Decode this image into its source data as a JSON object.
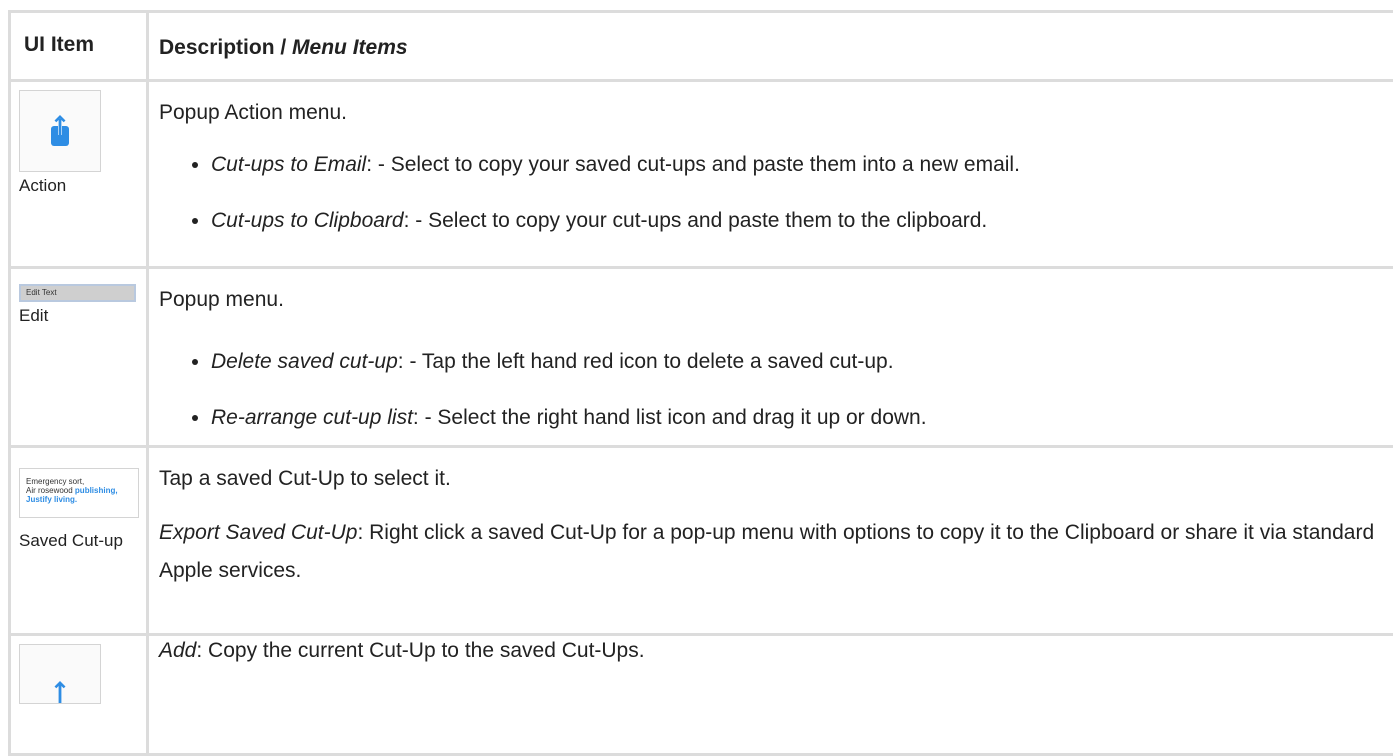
{
  "header": {
    "col1": "UI Item",
    "col2_plain": "Description / ",
    "col2_italic": "Menu Items"
  },
  "rows": {
    "action": {
      "icon": "share-icon",
      "label": "Action",
      "intro": "Popup Action menu.",
      "items": [
        {
          "term": "Cut-ups to Email",
          "text": ": - Select to copy your saved cut-ups and paste them into a new email."
        },
        {
          "term": "Cut-ups to Clipboard",
          "text": ": - Select to copy your cut-ups and paste them to the clipboard."
        }
      ]
    },
    "edit": {
      "button_text": "Edit Text",
      "label": "Edit",
      "intro": "Popup menu.",
      "items": [
        {
          "term": "Delete saved cut-up",
          "text": ": - Tap the left hand red icon to delete a saved cut-up."
        },
        {
          "term": "Re-arrange cut-up list",
          "text": ": - Select the right hand list icon and drag it up or down."
        }
      ]
    },
    "saved": {
      "thumb_line1": "Emergency sort,",
      "thumb_line2_plain": "Air rosewood ",
      "thumb_line2_blue": "publishing,",
      "thumb_line3_blue": "Justify living.",
      "label": "Saved Cut-up",
      "intro": "Tap a saved Cut-Up to select it.",
      "export_term": "Export Saved Cut-Up",
      "export_text": ": Right click a saved Cut-Up for a pop-up menu with options to copy it to the Clipboard or share it via standard Apple services."
    },
    "add": {
      "icon": "share-icon",
      "term": "Add",
      "text": ": Copy the current Cut-Up to the saved Cut-Ups."
    }
  },
  "colors": {
    "border": "#dcdcdc",
    "icon_blue": "#2e8de4",
    "text": "#222222"
  }
}
